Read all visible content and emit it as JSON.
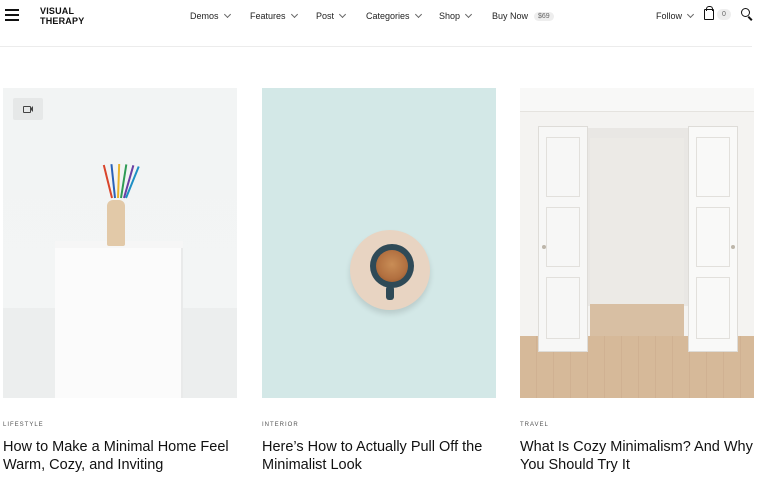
{
  "header": {
    "logo": "VISUAL\nTHERAPY",
    "nav": [
      {
        "label": "Demos",
        "has_dropdown": true
      },
      {
        "label": "Features",
        "has_dropdown": true
      },
      {
        "label": "Post",
        "has_dropdown": true
      },
      {
        "label": "Categories",
        "has_dropdown": true
      },
      {
        "label": "Shop",
        "has_dropdown": true
      },
      {
        "label": "Buy Now",
        "badge": "$69"
      }
    ],
    "follow_label": "Follow",
    "cart_count": "0"
  },
  "posts": [
    {
      "category": "LIFESTYLE",
      "title": "How to Make a Minimal Home Feel Warm, Cozy, and Inviting",
      "has_video": true
    },
    {
      "category": "INTERIOR",
      "title": "Here’s How to Actually Pull Off the Minimalist Look"
    },
    {
      "category": "TRAVEL",
      "title": "What Is Cozy Minimalism? And Why You Should Try It"
    }
  ]
}
